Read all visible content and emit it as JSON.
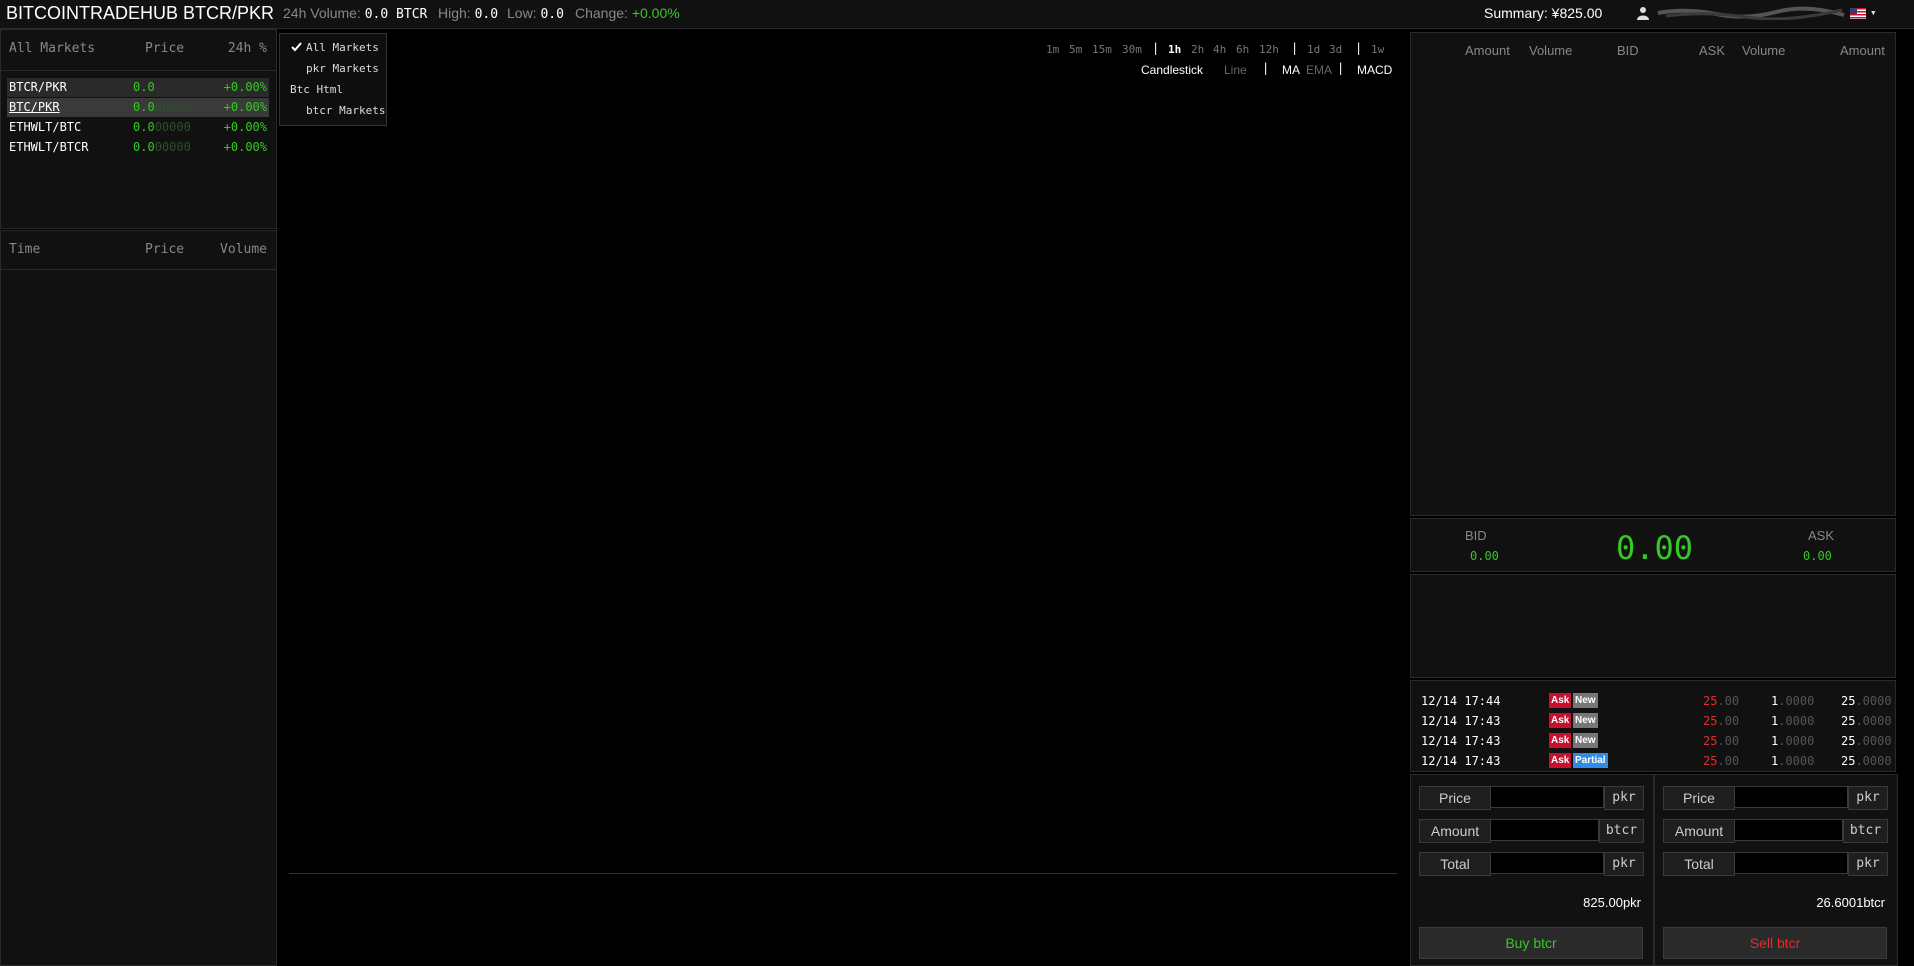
{
  "header": {
    "brand": "BITCOINTRADEHUB BTCR/PKR",
    "volume_label": "24h Volume:",
    "volume_value": "0.0 BTCR",
    "high_label": "High:",
    "high_value": "0.0",
    "low_label": "Low:",
    "low_value": "0.0",
    "change_label": "Change:",
    "change_value": "+0.00%",
    "summary": "Summary: ¥825.00"
  },
  "markets": {
    "headers": {
      "market": "All Markets",
      "price": "Price",
      "change": "24h %"
    },
    "rows": [
      {
        "pair": "BTCR/PKR",
        "price_main": "0.0",
        "price_dim": "",
        "change": "+0.00%"
      },
      {
        "pair": "BTC/PKR",
        "price_main": "0.0",
        "price_dim": "00000",
        "change": "+0.00%"
      },
      {
        "pair": "ETHWLT/BTC",
        "price_main": "0.0",
        "price_dim": "00000",
        "change": "+0.00%"
      },
      {
        "pair": "ETHWLT/BTCR",
        "price_main": "0.0",
        "price_dim": "00000",
        "change": "+0.00%"
      }
    ]
  },
  "trades": {
    "headers": {
      "time": "Time",
      "price": "Price",
      "volume": "Volume"
    }
  },
  "dropdown": {
    "items": [
      "All Markets",
      "pkr Markets",
      "Btc Html",
      "btcr Markets"
    ]
  },
  "chart": {
    "timeframes": [
      "1m",
      "5m",
      "15m",
      "30m",
      "1h",
      "2h",
      "4h",
      "6h",
      "12h",
      "1d",
      "3d",
      "1w"
    ],
    "active_timeframe": "1h",
    "types": [
      "Candlestick",
      "Line"
    ],
    "indicators": [
      "MA",
      "EMA",
      "MACD"
    ]
  },
  "orderbook": {
    "headers": [
      "Amount",
      "Volume",
      "BID",
      "ASK",
      "Volume",
      "Amount"
    ]
  },
  "ticker": {
    "bid_label": "BID",
    "bid_value": "0.00",
    "last_price": "0.00",
    "ask_label": "ASK",
    "ask_value": "0.00"
  },
  "history": [
    {
      "time": "12/14 17:44",
      "side": "Ask",
      "status": "New",
      "price_main": "25",
      "price_dec": ".00",
      "amount_main": "1",
      "amount_dec": ".0000",
      "total_main": "25",
      "total_dec": ".0000"
    },
    {
      "time": "12/14 17:43",
      "side": "Ask",
      "status": "New",
      "price_main": "25",
      "price_dec": ".00",
      "amount_main": "1",
      "amount_dec": ".0000",
      "total_main": "25",
      "total_dec": ".0000"
    },
    {
      "time": "12/14 17:43",
      "side": "Ask",
      "status": "New",
      "price_main": "25",
      "price_dec": ".00",
      "amount_main": "1",
      "amount_dec": ".0000",
      "total_main": "25",
      "total_dec": ".0000"
    },
    {
      "time": "12/14 17:43",
      "side": "Ask",
      "status": "Partial",
      "price_main": "25",
      "price_dec": ".00",
      "amount_main": "1",
      "amount_dec": ".0000",
      "total_main": "25",
      "total_dec": ".0000"
    }
  ],
  "buy_form": {
    "price_label": "Price",
    "price_unit": "pkr",
    "amount_label": "Amount",
    "amount_unit": "btcr",
    "total_label": "Total",
    "total_unit": "pkr",
    "balance_value": "825.00",
    "balance_unit": "pkr",
    "button": "Buy btcr",
    "button_color": "#34c924"
  },
  "sell_form": {
    "price_label": "Price",
    "price_unit": "pkr",
    "amount_label": "Amount",
    "amount_unit": "btcr",
    "total_label": "Total",
    "total_unit": "pkr",
    "balance_value": "26.6001",
    "balance_unit": "btcr",
    "button": "Sell btcr",
    "button_color": "#e8282b"
  },
  "icons": {
    "user": "user-icon",
    "flag": "us-flag-icon",
    "check": "check-icon",
    "caret": "caret-down-icon"
  }
}
